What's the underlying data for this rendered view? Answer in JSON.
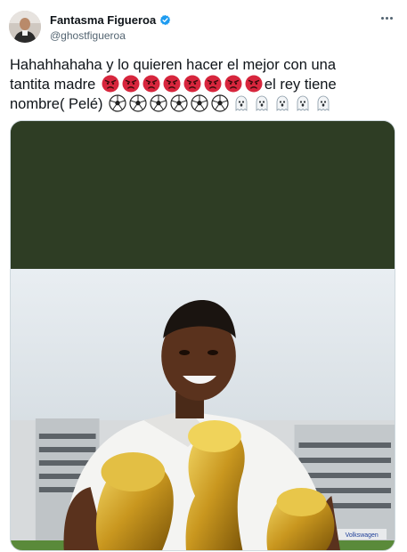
{
  "tweet": {
    "author": {
      "display_name": "Fantasma Figueroa",
      "handle": "@ghostfigueroa",
      "verified": true,
      "avatar_icon": "profile-avatar"
    },
    "more_icon": "more-horizontal-icon",
    "text": {
      "line1": "Hahahhahaha y lo quieren hacer el mejor con una",
      "line2_prefix": "tantita madre",
      "line2_emoji": "angry-face",
      "line2_emoji_count": 8,
      "line2_suffix": "el rey tiene",
      "line3_prefix": "nombre( Pelé)",
      "line3_ball_emoji": "soccer-ball",
      "line3_ball_count": 6,
      "line3_ghost_emoji": "ghost",
      "line3_ghost_count": 5
    },
    "media": {
      "description_icon": "photo-pele-trophies",
      "banner_text": "Volkswagen"
    }
  },
  "colors": {
    "text": "#0f1419",
    "secondary": "#536471",
    "verified": "#1d9bf0",
    "media_band": "#2e3d24"
  }
}
